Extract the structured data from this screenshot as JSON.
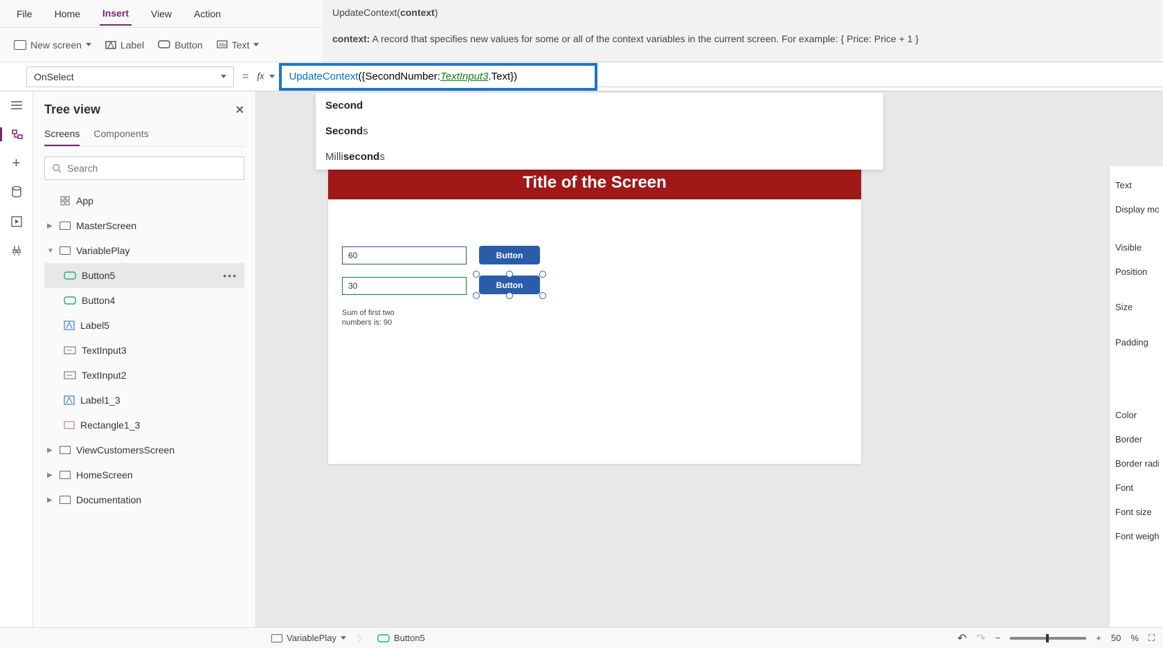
{
  "menu": {
    "file": "File",
    "home": "Home",
    "insert": "Insert",
    "view": "View",
    "action": "Action"
  },
  "ribbon": {
    "new_screen": "New screen",
    "label": "Label",
    "button": "Button",
    "text": "Text"
  },
  "tooltip": {
    "signature_fn": "UpdateContext(",
    "signature_arg": "context",
    "signature_close": ")",
    "desc_label": "context:",
    "desc_text": " A record that specifies new values for some or all of the context variables in the current screen. For example: { Price: Price + 1 }"
  },
  "formula": {
    "property": "OnSelect",
    "fn": "UpdateContext",
    "body_open": "({SecondNumber: ",
    "ref": "TextInput3",
    "body_close": ".Text})"
  },
  "autocomplete": {
    "items": [
      {
        "bold": "Second",
        "rest": ""
      },
      {
        "bold": "Second",
        "rest": "s"
      },
      {
        "pre": "Milli",
        "bold": "second",
        "rest": "s"
      }
    ]
  },
  "tree": {
    "title": "Tree view",
    "tabs": {
      "screens": "Screens",
      "components": "Components"
    },
    "search_placeholder": "Search",
    "app": "App",
    "master": "MasterScreen",
    "variableplay": "VariablePlay",
    "button5": "Button5",
    "button4": "Button4",
    "label5": "Label5",
    "textinput3": "TextInput3",
    "textinput2": "TextInput2",
    "label1_3": "Label1_3",
    "rectangle1_3": "Rectangle1_3",
    "viewcustomers": "ViewCustomersScreen",
    "homescreen": "HomeScreen",
    "documentation": "Documentation"
  },
  "canvas": {
    "screen_title": "Title of the Screen",
    "input1": "60",
    "input2": "30",
    "button_label": "Button",
    "sum_text": "Sum of first two numbers is: 90"
  },
  "props": {
    "text": "Text",
    "display_mode": "Display mod",
    "visible": "Visible",
    "position": "Position",
    "size": "Size",
    "padding": "Padding",
    "color": "Color",
    "border": "Border",
    "border_radius": "Border radiu",
    "font": "Font",
    "font_size": "Font size",
    "font_weight": "Font weight"
  },
  "status": {
    "screen": "VariablePlay",
    "control": "Button5",
    "zoom": "50",
    "percent": "%"
  }
}
